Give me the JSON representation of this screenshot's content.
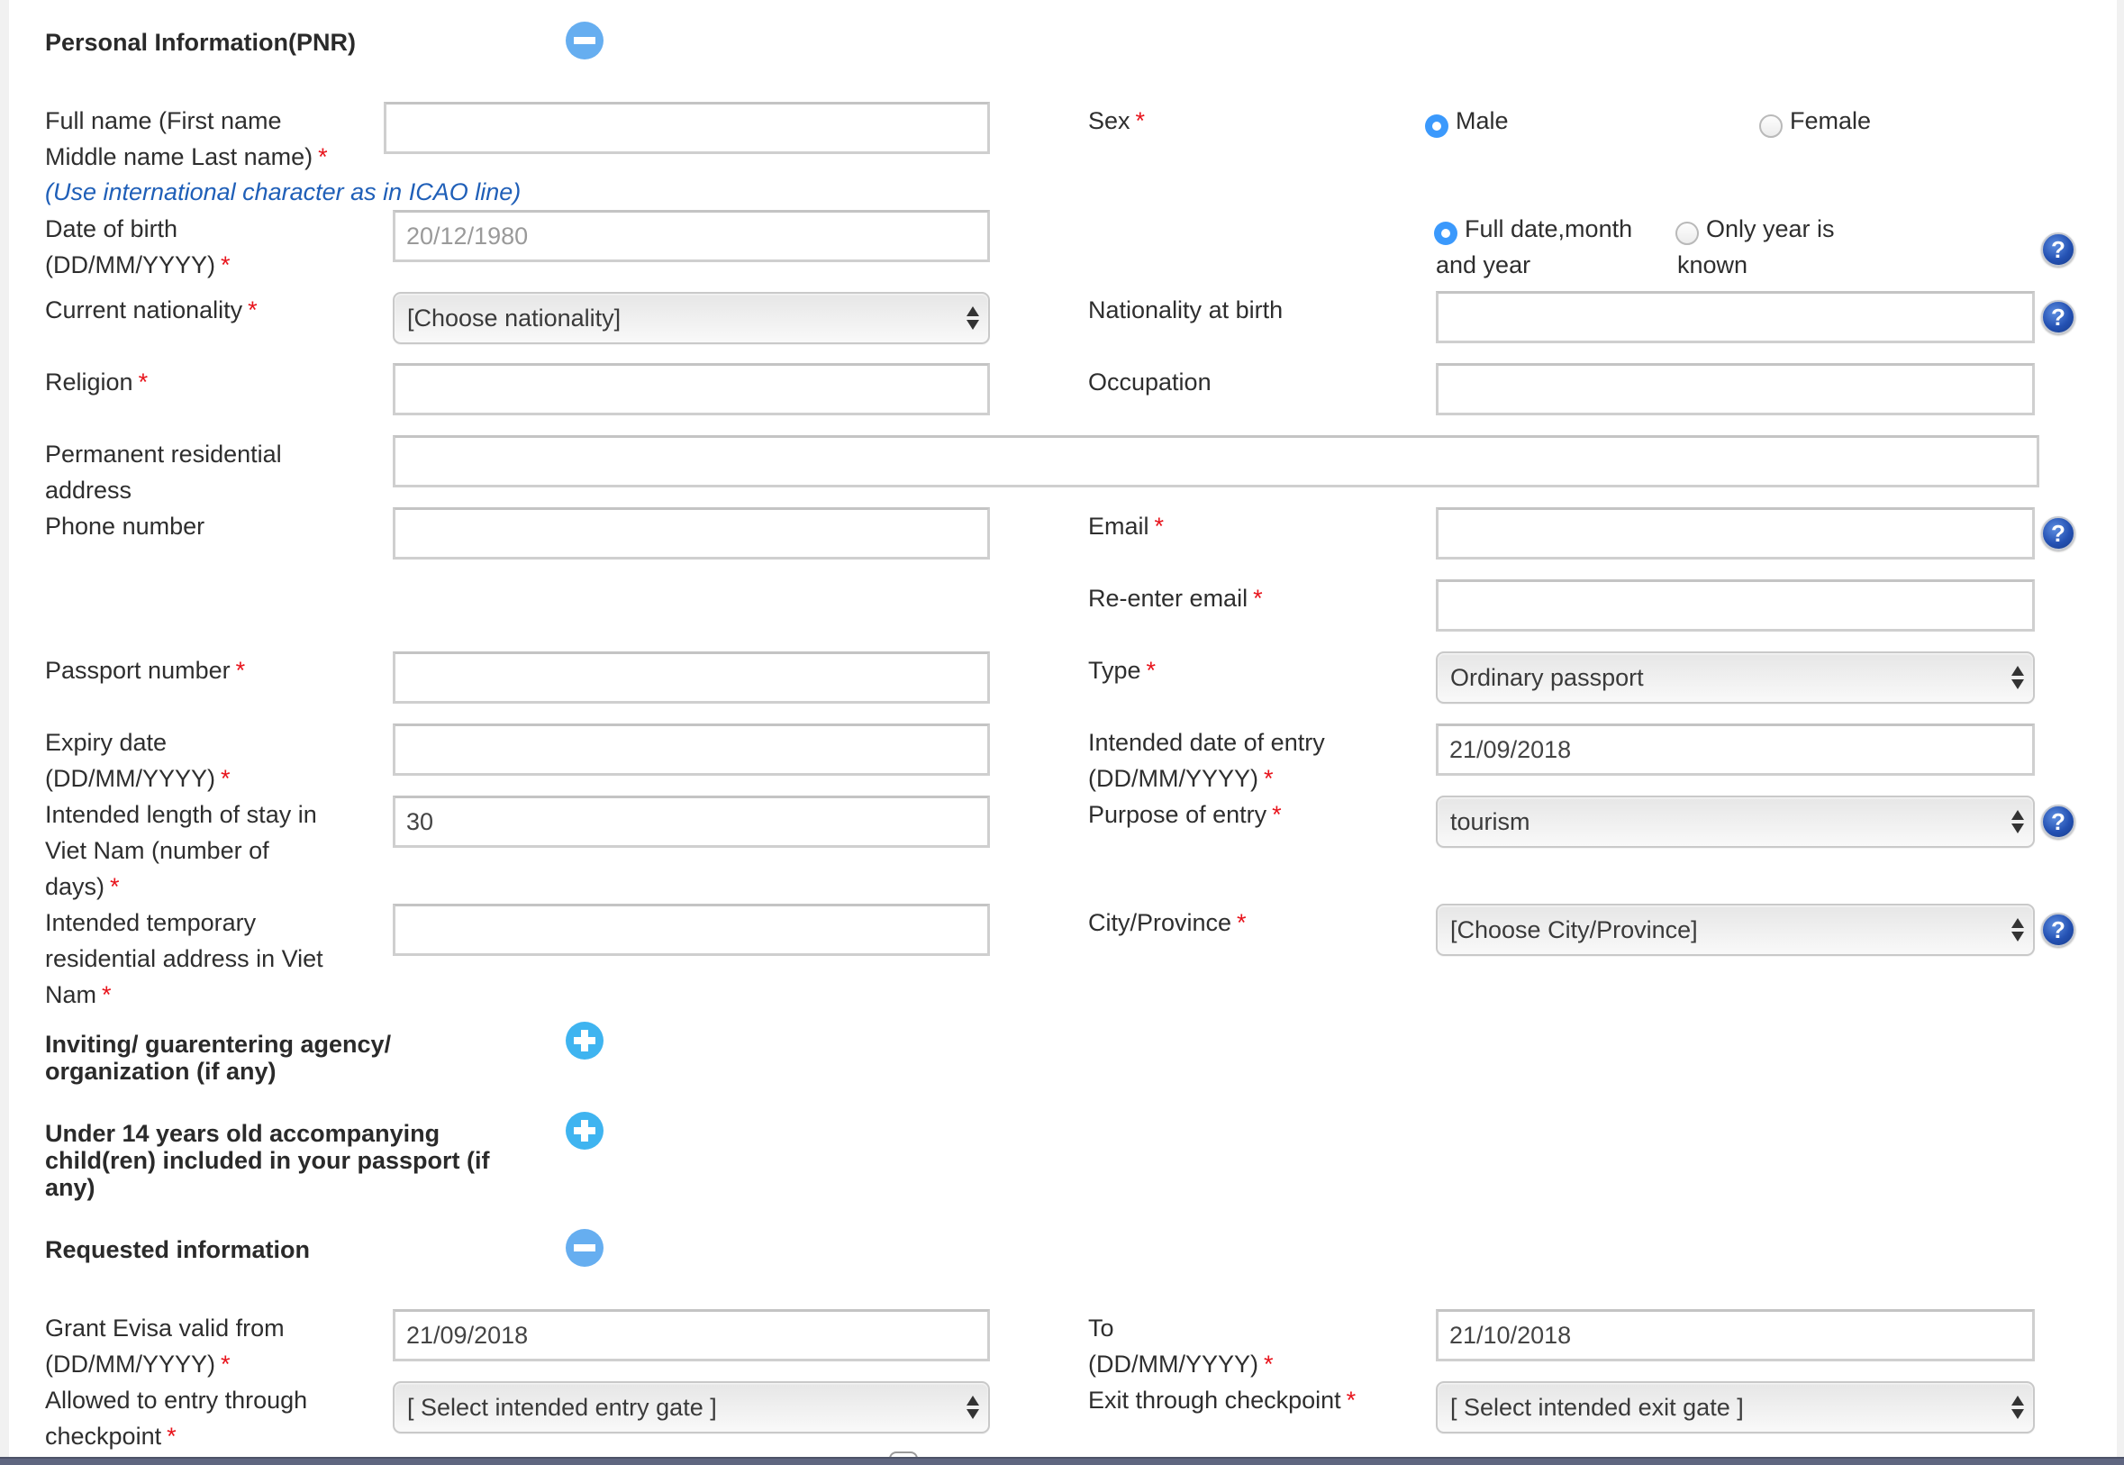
{
  "colors": {
    "required_marker": "#e8141c",
    "hint_text": "#1f5fb8",
    "collapse_icon": "#66aef0",
    "expand_icon": "#3fb4f0",
    "radio_selected": "#3b99fc",
    "help_icon": "#2451b3"
  },
  "icons": {
    "collapse": "minus-circle-icon",
    "expand": "plus-circle-icon",
    "help": "question-mark-icon",
    "help_glyph": "?",
    "select_arrows": "up-down-arrows-icon"
  },
  "required_marker": "*",
  "sections": {
    "personal": {
      "title": "Personal Information(PNR)",
      "state": "expanded"
    },
    "inviting": {
      "title_line1": "Inviting/ guarentering agency/",
      "title_line2": "organization (if any)",
      "state": "collapsed"
    },
    "children": {
      "title_line1": "Under 14 years old accompanying",
      "title_line2": "child(ren) included in your passport (if",
      "title_line3": "any)",
      "state": "collapsed"
    },
    "requested": {
      "title": "Requested information",
      "state": "expanded"
    }
  },
  "personal": {
    "full_name": {
      "label_line1": "Full name (First name",
      "label_line2": "Middle name Last name)",
      "hint": "(Use international character as in ICAO line)",
      "value": "",
      "required": true
    },
    "sex": {
      "label": "Sex",
      "required": true,
      "options": [
        {
          "label": "Male",
          "selected": true
        },
        {
          "label": "Female",
          "selected": false
        }
      ]
    },
    "date_of_birth": {
      "label_line1": "Date of birth",
      "label_line2": "(DD/MM/YYYY)",
      "placeholder": "20/12/1980",
      "value": "",
      "required": true
    },
    "dob_precision": {
      "options": [
        {
          "label_line1": "Full date,month",
          "label_line2": "and year",
          "selected": true
        },
        {
          "label_line1": "Only year is",
          "label_line2": "known",
          "selected": false
        }
      ]
    },
    "current_nationality": {
      "label": "Current nationality",
      "selected": "[Choose nationality]",
      "required": true
    },
    "nationality_at_birth": {
      "label": "Nationality at birth",
      "value": ""
    },
    "religion": {
      "label": "Religion",
      "value": "",
      "required": true
    },
    "occupation": {
      "label": "Occupation",
      "value": ""
    },
    "permanent_address": {
      "label_line1": "Permanent residential",
      "label_line2": "address",
      "value": ""
    },
    "phone": {
      "label": "Phone number",
      "value": ""
    },
    "email": {
      "label": "Email",
      "value": "",
      "required": true
    },
    "reenter_email": {
      "label": "Re-enter email",
      "value": "",
      "required": true
    },
    "passport_number": {
      "label": "Passport number",
      "value": "",
      "required": true
    },
    "passport_type": {
      "label": "Type",
      "selected": "Ordinary passport",
      "required": true
    },
    "expiry_date": {
      "label_line1": "Expiry date",
      "label_line2": "(DD/MM/YYYY)",
      "value": "",
      "required": true
    },
    "entry_date": {
      "label_line1": "Intended date of entry",
      "label_line2": "(DD/MM/YYYY)",
      "value": "21/09/2018",
      "required": true
    },
    "length_of_stay": {
      "label_line1": "Intended length of stay in",
      "label_line2": "Viet Nam (number of",
      "label_line3": "days)",
      "value": "30",
      "required": true
    },
    "purpose": {
      "label": "Purpose of entry",
      "selected": "tourism",
      "required": true
    },
    "temp_address": {
      "label_line1": "Intended temporary",
      "label_line2": "residential address in Viet",
      "label_line3": "Nam",
      "value": "",
      "required": true
    },
    "city": {
      "label": "City/Province",
      "selected": "[Choose City/Province]",
      "required": true
    }
  },
  "requested": {
    "valid_from": {
      "label_line1": "Grant Evisa valid from",
      "label_line2": "(DD/MM/YYYY)",
      "value": "21/09/2018",
      "required": true
    },
    "valid_to": {
      "label_line1": "To",
      "label_line2": "(DD/MM/YYYY)",
      "value": "21/10/2018",
      "required": true
    },
    "entry_gate": {
      "label_line1": "Allowed to entry through",
      "label_line2": "checkpoint",
      "selected": "[ Select intended entry gate ]",
      "required": true
    },
    "exit_gate": {
      "label": "Exit through checkpoint",
      "selected": "[ Select intended exit gate ]",
      "required": true
    }
  }
}
